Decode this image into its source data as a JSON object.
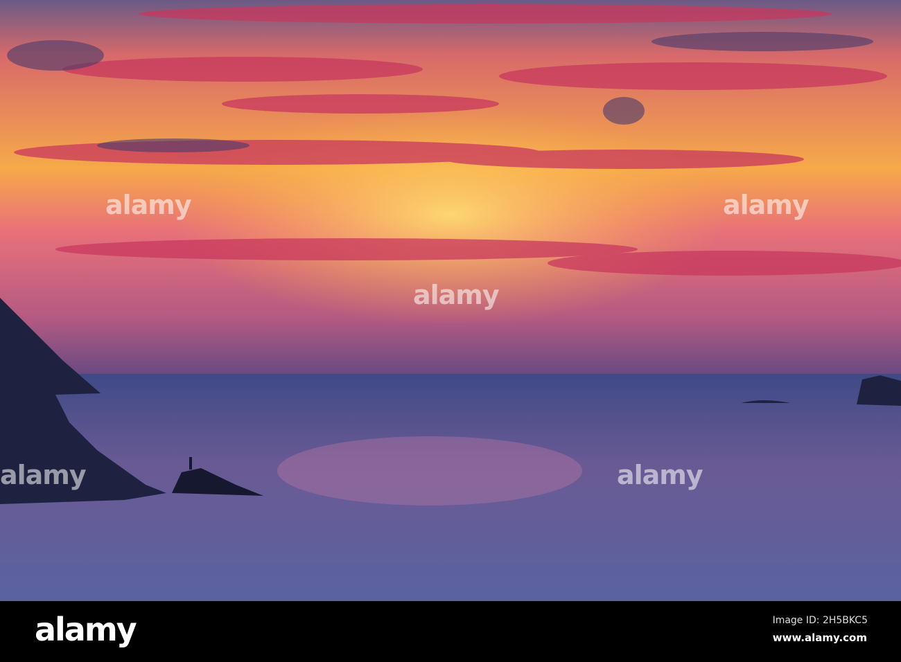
{
  "watermark": {
    "logo": "alamy",
    "image_id": "Image ID: 2H5BKC5",
    "site": "www.alamy.com"
  },
  "colors": {
    "sky_top": "#5a4a78",
    "sky_glow": "#f7b83a",
    "cloud": "#d8456a",
    "sea": "#4a4f8a",
    "bar": "#000000"
  }
}
